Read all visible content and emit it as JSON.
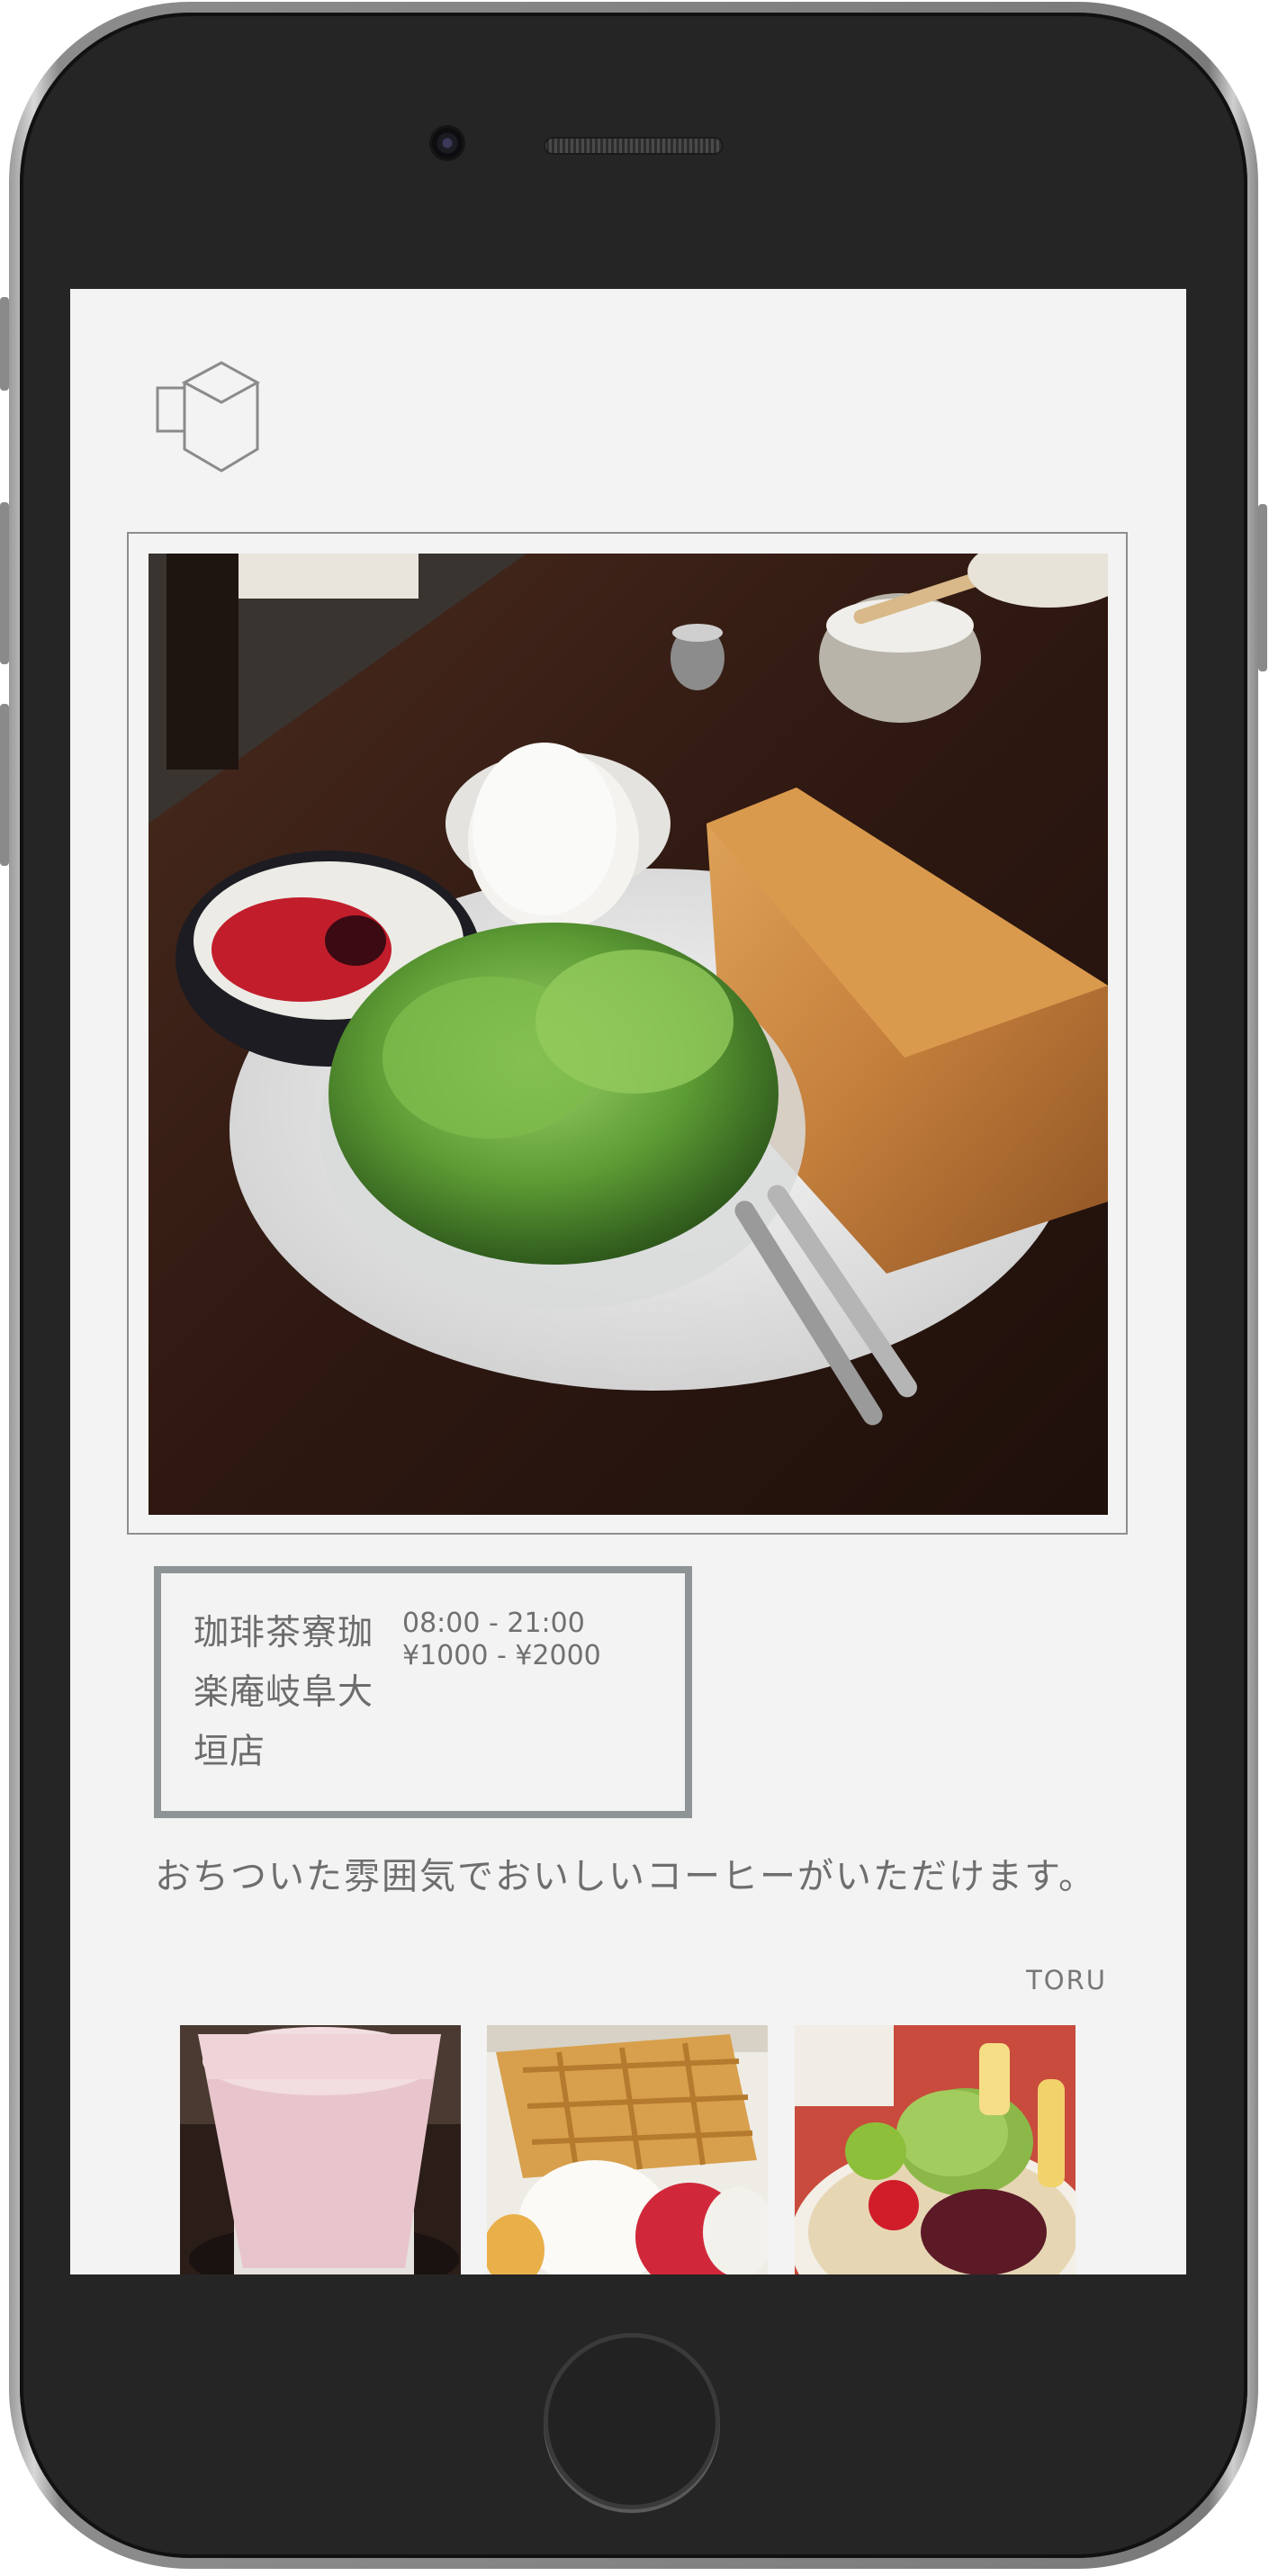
{
  "device": {
    "name": "smartphone",
    "icons": [
      "camera-icon",
      "speaker-icon",
      "home-button-icon"
    ]
  },
  "app": {
    "logo_icon": "box-logo-icon"
  },
  "main_photo": {
    "subject": "breakfast plate with toast, salad, egg and yogurt"
  },
  "shop": {
    "name": "珈琲茶寮珈楽庵岐阜大垣店",
    "hours": "08:00 - 21:00",
    "price": "¥1000 - ¥2000"
  },
  "review": {
    "text": "おちついた雰囲気でおいしいコーヒーがいただけます。",
    "author": "TORU"
  },
  "thumbnails": [
    {
      "subject": "strawberry milk drink"
    },
    {
      "subject": "waffle with cream and strawberry"
    },
    {
      "subject": "matcha ice cream anmitsu"
    }
  ],
  "colors": {
    "screen_background": "#f3f3f3",
    "frame_border": "#8e9396",
    "text": "#6e6e6e"
  }
}
